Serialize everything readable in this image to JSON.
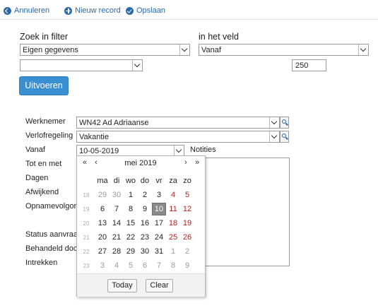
{
  "toolbar": {
    "cancel": "Annuleren",
    "new_record": "Nieuw record",
    "save": "Opslaan"
  },
  "filter": {
    "search_label": "Zoek in filter",
    "search_value": "Eigen gegevens",
    "field_label": "in het veld",
    "field_value": "Vanaf",
    "second_select_value": "",
    "amount_value": "250",
    "run_button": "Uitvoeren"
  },
  "form": {
    "employee_label": "Werknemer",
    "employee_value": "WN42 Ad Adriaanse",
    "leave_label": "Verlofregeling",
    "leave_value": "Vakantie",
    "from_label": "Vanaf",
    "from_value": "10-05-2019",
    "notes_label": "Notities",
    "until_label": "Tot en met",
    "days_label": "Dagen",
    "deviating_label": "Afwijkend",
    "order_label": "Opnamevolgorde",
    "status_label": "Status aanvraag",
    "handled_label": "Behandeld door",
    "withdraw_label": "Intrekken"
  },
  "calendar": {
    "prev_year": "«",
    "prev_month": "‹",
    "title": "mei 2019",
    "next_month": "›",
    "next_year": "»",
    "weekdays": [
      "ma",
      "di",
      "wo",
      "do",
      "vr",
      "za",
      "zo"
    ],
    "weeks": [
      {
        "week": "18",
        "days": [
          {
            "d": "29",
            "t": "other"
          },
          {
            "d": "30",
            "t": "other"
          },
          {
            "d": "1",
            "t": ""
          },
          {
            "d": "2",
            "t": ""
          },
          {
            "d": "3",
            "t": ""
          },
          {
            "d": "4",
            "t": "weekend"
          },
          {
            "d": "5",
            "t": "weekend"
          }
        ]
      },
      {
        "week": "19",
        "days": [
          {
            "d": "6",
            "t": ""
          },
          {
            "d": "7",
            "t": ""
          },
          {
            "d": "8",
            "t": ""
          },
          {
            "d": "9",
            "t": ""
          },
          {
            "d": "10",
            "t": "selected"
          },
          {
            "d": "11",
            "t": "weekend"
          },
          {
            "d": "12",
            "t": "weekend"
          }
        ]
      },
      {
        "week": "20",
        "days": [
          {
            "d": "13",
            "t": ""
          },
          {
            "d": "14",
            "t": ""
          },
          {
            "d": "15",
            "t": ""
          },
          {
            "d": "16",
            "t": ""
          },
          {
            "d": "17",
            "t": ""
          },
          {
            "d": "18",
            "t": "weekend"
          },
          {
            "d": "19",
            "t": "weekend"
          }
        ]
      },
      {
        "week": "21",
        "days": [
          {
            "d": "20",
            "t": ""
          },
          {
            "d": "21",
            "t": ""
          },
          {
            "d": "22",
            "t": ""
          },
          {
            "d": "23",
            "t": ""
          },
          {
            "d": "24",
            "t": ""
          },
          {
            "d": "25",
            "t": "weekend"
          },
          {
            "d": "26",
            "t": "weekend"
          }
        ]
      },
      {
        "week": "22",
        "days": [
          {
            "d": "27",
            "t": ""
          },
          {
            "d": "28",
            "t": ""
          },
          {
            "d": "29",
            "t": ""
          },
          {
            "d": "30",
            "t": ""
          },
          {
            "d": "31",
            "t": ""
          },
          {
            "d": "1",
            "t": "other"
          },
          {
            "d": "2",
            "t": "other"
          }
        ]
      },
      {
        "week": "23",
        "days": [
          {
            "d": "3",
            "t": "other"
          },
          {
            "d": "4",
            "t": "other"
          },
          {
            "d": "5",
            "t": "other"
          },
          {
            "d": "6",
            "t": "other"
          },
          {
            "d": "7",
            "t": "other"
          },
          {
            "d": "8",
            "t": "other"
          },
          {
            "d": "9",
            "t": "other"
          }
        ]
      }
    ],
    "today_button": "Today",
    "clear_button": "Clear"
  },
  "colors": {
    "accent": "#2a6aa8",
    "button_blue": "#3a8fd3",
    "weekend_red": "#b32020",
    "selected_grey": "#8a8a8a"
  },
  "icons": [
    "back-arrow-icon",
    "plus-icon",
    "check-icon",
    "chevron-down-icon",
    "lookup-search-icon"
  ]
}
